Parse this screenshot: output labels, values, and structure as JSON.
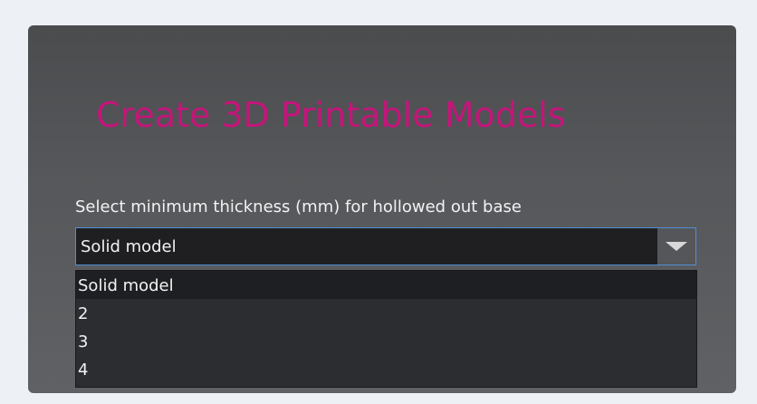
{
  "app": {
    "title": "Create 3D Printable Models",
    "title_color": "#c3167a"
  },
  "thickness_field": {
    "label": "Select minimum thickness (mm) for hollowed out base",
    "selected_value": "Solid model",
    "options": [
      "Solid model",
      "2",
      "3",
      "4"
    ],
    "highlighted_option": "Solid model",
    "focus_border_color": "#4f8fd6"
  }
}
